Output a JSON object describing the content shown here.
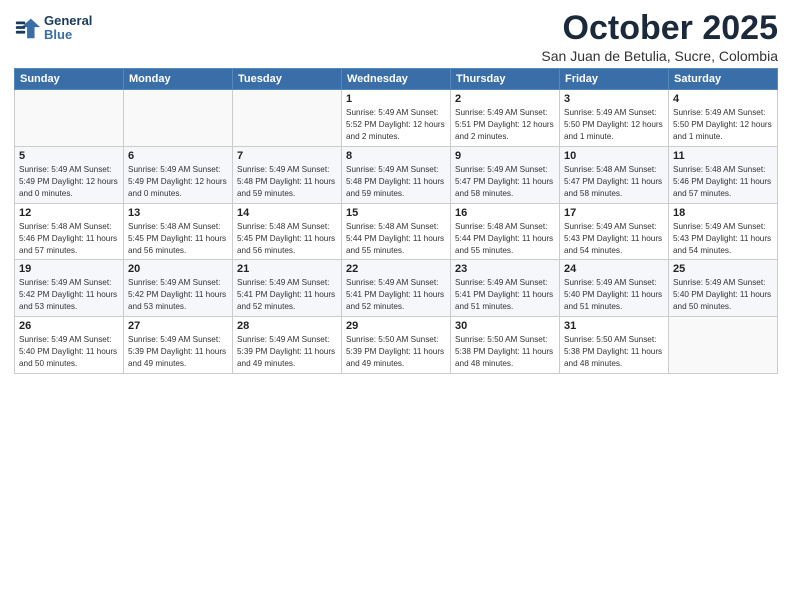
{
  "header": {
    "logo_line1": "General",
    "logo_line2": "Blue",
    "month": "October 2025",
    "location": "San Juan de Betulia, Sucre, Colombia"
  },
  "weekdays": [
    "Sunday",
    "Monday",
    "Tuesday",
    "Wednesday",
    "Thursday",
    "Friday",
    "Saturday"
  ],
  "weeks": [
    [
      {
        "day": "",
        "info": ""
      },
      {
        "day": "",
        "info": ""
      },
      {
        "day": "",
        "info": ""
      },
      {
        "day": "1",
        "info": "Sunrise: 5:49 AM\nSunset: 5:52 PM\nDaylight: 12 hours and 2 minutes."
      },
      {
        "day": "2",
        "info": "Sunrise: 5:49 AM\nSunset: 5:51 PM\nDaylight: 12 hours and 2 minutes."
      },
      {
        "day": "3",
        "info": "Sunrise: 5:49 AM\nSunset: 5:50 PM\nDaylight: 12 hours and 1 minute."
      },
      {
        "day": "4",
        "info": "Sunrise: 5:49 AM\nSunset: 5:50 PM\nDaylight: 12 hours and 1 minute."
      }
    ],
    [
      {
        "day": "5",
        "info": "Sunrise: 5:49 AM\nSunset: 5:49 PM\nDaylight: 12 hours and 0 minutes."
      },
      {
        "day": "6",
        "info": "Sunrise: 5:49 AM\nSunset: 5:49 PM\nDaylight: 12 hours and 0 minutes."
      },
      {
        "day": "7",
        "info": "Sunrise: 5:49 AM\nSunset: 5:48 PM\nDaylight: 11 hours and 59 minutes."
      },
      {
        "day": "8",
        "info": "Sunrise: 5:49 AM\nSunset: 5:48 PM\nDaylight: 11 hours and 59 minutes."
      },
      {
        "day": "9",
        "info": "Sunrise: 5:49 AM\nSunset: 5:47 PM\nDaylight: 11 hours and 58 minutes."
      },
      {
        "day": "10",
        "info": "Sunrise: 5:48 AM\nSunset: 5:47 PM\nDaylight: 11 hours and 58 minutes."
      },
      {
        "day": "11",
        "info": "Sunrise: 5:48 AM\nSunset: 5:46 PM\nDaylight: 11 hours and 57 minutes."
      }
    ],
    [
      {
        "day": "12",
        "info": "Sunrise: 5:48 AM\nSunset: 5:46 PM\nDaylight: 11 hours and 57 minutes."
      },
      {
        "day": "13",
        "info": "Sunrise: 5:48 AM\nSunset: 5:45 PM\nDaylight: 11 hours and 56 minutes."
      },
      {
        "day": "14",
        "info": "Sunrise: 5:48 AM\nSunset: 5:45 PM\nDaylight: 11 hours and 56 minutes."
      },
      {
        "day": "15",
        "info": "Sunrise: 5:48 AM\nSunset: 5:44 PM\nDaylight: 11 hours and 55 minutes."
      },
      {
        "day": "16",
        "info": "Sunrise: 5:48 AM\nSunset: 5:44 PM\nDaylight: 11 hours and 55 minutes."
      },
      {
        "day": "17",
        "info": "Sunrise: 5:49 AM\nSunset: 5:43 PM\nDaylight: 11 hours and 54 minutes."
      },
      {
        "day": "18",
        "info": "Sunrise: 5:49 AM\nSunset: 5:43 PM\nDaylight: 11 hours and 54 minutes."
      }
    ],
    [
      {
        "day": "19",
        "info": "Sunrise: 5:49 AM\nSunset: 5:42 PM\nDaylight: 11 hours and 53 minutes."
      },
      {
        "day": "20",
        "info": "Sunrise: 5:49 AM\nSunset: 5:42 PM\nDaylight: 11 hours and 53 minutes."
      },
      {
        "day": "21",
        "info": "Sunrise: 5:49 AM\nSunset: 5:41 PM\nDaylight: 11 hours and 52 minutes."
      },
      {
        "day": "22",
        "info": "Sunrise: 5:49 AM\nSunset: 5:41 PM\nDaylight: 11 hours and 52 minutes."
      },
      {
        "day": "23",
        "info": "Sunrise: 5:49 AM\nSunset: 5:41 PM\nDaylight: 11 hours and 51 minutes."
      },
      {
        "day": "24",
        "info": "Sunrise: 5:49 AM\nSunset: 5:40 PM\nDaylight: 11 hours and 51 minutes."
      },
      {
        "day": "25",
        "info": "Sunrise: 5:49 AM\nSunset: 5:40 PM\nDaylight: 11 hours and 50 minutes."
      }
    ],
    [
      {
        "day": "26",
        "info": "Sunrise: 5:49 AM\nSunset: 5:40 PM\nDaylight: 11 hours and 50 minutes."
      },
      {
        "day": "27",
        "info": "Sunrise: 5:49 AM\nSunset: 5:39 PM\nDaylight: 11 hours and 49 minutes."
      },
      {
        "day": "28",
        "info": "Sunrise: 5:49 AM\nSunset: 5:39 PM\nDaylight: 11 hours and 49 minutes."
      },
      {
        "day": "29",
        "info": "Sunrise: 5:50 AM\nSunset: 5:39 PM\nDaylight: 11 hours and 49 minutes."
      },
      {
        "day": "30",
        "info": "Sunrise: 5:50 AM\nSunset: 5:38 PM\nDaylight: 11 hours and 48 minutes."
      },
      {
        "day": "31",
        "info": "Sunrise: 5:50 AM\nSunset: 5:38 PM\nDaylight: 11 hours and 48 minutes."
      },
      {
        "day": "",
        "info": ""
      }
    ]
  ]
}
